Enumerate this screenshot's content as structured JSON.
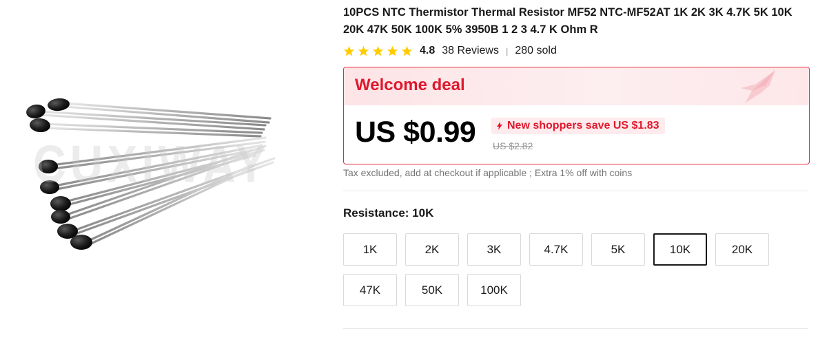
{
  "product": {
    "title": "10PCS NTC Thermistor Thermal Resistor MF52 NTC-MF52AT 1K 2K 3K 4.7K 5K 10K 20K 47K 50K 100K 5% 3950B 1 2 3 4.7 K Ohm R",
    "image_watermark": "CUXIWAY",
    "rating": {
      "value": "4.8",
      "stars": 5,
      "star_color": "#ffcc00",
      "reviews": "38 Reviews",
      "separator": "|",
      "sold": "280 sold"
    }
  },
  "deal": {
    "title": "Welcome deal",
    "price": "US $0.99",
    "save_text": "New shoppers save US $1.83",
    "old_price": "US $2.82",
    "accent_color": "#e0182d",
    "icons": [
      "tag-icon",
      "ribbon-decoration-icon"
    ]
  },
  "tax_note": "Tax excluded, add at checkout if applicable ; Extra 1% off with coins",
  "sku": {
    "label": "Resistance: 10K",
    "selected": "10K",
    "options": [
      "1K",
      "2K",
      "3K",
      "4.7K",
      "5K",
      "10K",
      "20K",
      "47K",
      "50K",
      "100K"
    ]
  }
}
